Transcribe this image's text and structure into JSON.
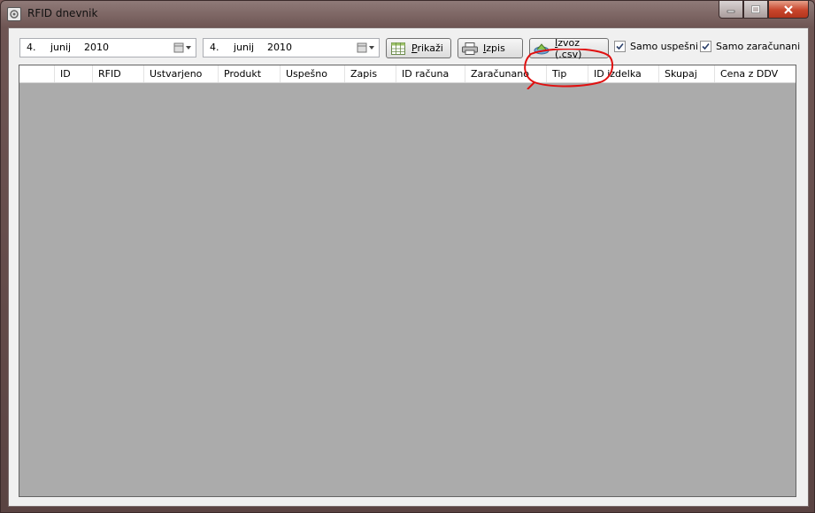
{
  "window": {
    "title": "RFID dnevnik"
  },
  "toolbar": {
    "date_from": {
      "day": "4.",
      "month": "junij",
      "year": "2010"
    },
    "date_to": {
      "day": "4.",
      "month": "junij",
      "year": "2010"
    },
    "show_label": "Prikaži",
    "print_label": "Izpis",
    "export_label": "Izvoz (.csv)",
    "only_successful_label": "Samo uspešni",
    "only_successful_checked": true,
    "only_billed_label": "Samo zaračunani",
    "only_billed_checked": true
  },
  "grid": {
    "columns": [
      "ID",
      "RFID",
      "Ustvarjeno",
      "Produkt",
      "Uspešno",
      "Zapis",
      "ID računa",
      "Zaračunano",
      "Tip",
      "ID izdelka",
      "Skupaj",
      "Cena z DDV"
    ],
    "rows": []
  },
  "colors": {
    "annotation": "#e01010",
    "grid_bg": "#ababab"
  }
}
